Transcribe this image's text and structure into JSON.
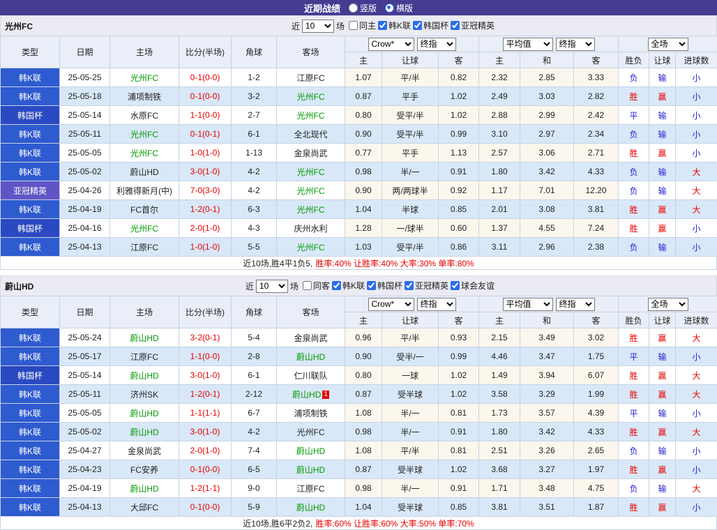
{
  "topbar": {
    "title": "近期战绩",
    "vertical_label": "竖版",
    "horizontal_label": "横版",
    "selected": "横版"
  },
  "league_colors": {
    "韩K联": "#2f5bd0",
    "韩国杯": "#2a49c2",
    "亚冠精英": "#6055c6"
  },
  "result_colors": {
    "win_red": "#e60000",
    "lose_blue": "#1f1fd0",
    "team_highlight_green": "#009900",
    "score_red": "#e60000"
  },
  "sections": [
    {
      "team": "光州FC",
      "filters": {
        "near_label": "近",
        "count": "10",
        "unit_label": "场",
        "checkboxes": [
          {
            "label": "同主",
            "checked": false
          },
          {
            "label": "韩K联",
            "checked": true
          },
          {
            "label": "韩国杯",
            "checked": true
          },
          {
            "label": "亚冠精英",
            "checked": true
          }
        ]
      },
      "selects": {
        "company": "Crow*",
        "company_stage": "终指",
        "average": "平均值",
        "average_stage": "终指",
        "scope": "全场"
      },
      "columns": {
        "type": "类型",
        "date": "日期",
        "home": "主场",
        "score": "比分(半场)",
        "corner": "角球",
        "away": "客场"
      },
      "sub_columns": [
        "主",
        "让球",
        "客",
        "主",
        "和",
        "客",
        "胜负",
        "让球",
        "进球数"
      ],
      "rows": [
        {
          "type": "韩K联",
          "date": "25-05-25",
          "home": "光州FC",
          "home_green": true,
          "score": "0-1(0-0)",
          "corner": "1-2",
          "away": "江原FC",
          "o1": "1.07",
          "hc": "平/半",
          "o2": "0.82",
          "a1": "2.32",
          "a2": "2.85",
          "a3": "3.33",
          "r1": "负",
          "r2": "输",
          "r3": "小"
        },
        {
          "type": "韩K联",
          "date": "25-05-18",
          "home": "浦项制铁",
          "score": "0-1(0-0)",
          "corner": "3-2",
          "away": "光州FC",
          "away_green": true,
          "o1": "0.87",
          "hc": "平手",
          "o2": "1.02",
          "a1": "2.49",
          "a2": "3.03",
          "a3": "2.82",
          "r1": "胜",
          "r2": "赢",
          "r3": "小"
        },
        {
          "type": "韩国杯",
          "date": "25-05-14",
          "home": "水原FC",
          "score": "1-1(0-0)",
          "corner": "2-7",
          "away": "光州FC",
          "away_green": true,
          "o1": "0.80",
          "hc": "受平/半",
          "o2": "1.02",
          "a1": "2.88",
          "a2": "2.99",
          "a3": "2.42",
          "r1": "平",
          "r2": "输",
          "r3": "小"
        },
        {
          "type": "韩K联",
          "date": "25-05-11",
          "home": "光州FC",
          "home_green": true,
          "score": "0-1(0-1)",
          "corner": "6-1",
          "away": "全北现代",
          "o1": "0.90",
          "hc": "受平/半",
          "o2": "0.99",
          "a1": "3.10",
          "a2": "2.97",
          "a3": "2.34",
          "r1": "负",
          "r2": "输",
          "r3": "小"
        },
        {
          "type": "韩K联",
          "date": "25-05-05",
          "home": "光州FC",
          "home_green": true,
          "score": "1-0(1-0)",
          "corner": "1-13",
          "away": "金泉尚武",
          "o1": "0.77",
          "hc": "平手",
          "o2": "1.13",
          "a1": "2.57",
          "a2": "3.06",
          "a3": "2.71",
          "r1": "胜",
          "r2": "赢",
          "r3": "小"
        },
        {
          "type": "韩K联",
          "date": "25-05-02",
          "home": "蔚山HD",
          "score": "3-0(1-0)",
          "corner": "4-2",
          "away": "光州FC",
          "away_green": true,
          "o1": "0.98",
          "hc": "半/一",
          "o2": "0.91",
          "a1": "1.80",
          "a2": "3.42",
          "a3": "4.33",
          "r1": "负",
          "r2": "输",
          "r3": "大"
        },
        {
          "type": "亚冠精英",
          "date": "25-04-26",
          "home": "利雅得新月(中)",
          "score": "7-0(3-0)",
          "corner": "4-2",
          "away": "光州FC",
          "away_green": true,
          "o1": "0.90",
          "hc": "两/两球半",
          "o2": "0.92",
          "a1": "1.17",
          "a2": "7.01",
          "a3": "12.20",
          "r1": "负",
          "r2": "输",
          "r3": "大"
        },
        {
          "type": "韩K联",
          "date": "25-04-19",
          "home": "FC首尔",
          "score": "1-2(0-1)",
          "corner": "6-3",
          "away": "光州FC",
          "away_green": true,
          "o1": "1.04",
          "hc": "半球",
          "o2": "0.85",
          "a1": "2.01",
          "a2": "3.08",
          "a3": "3.81",
          "r1": "胜",
          "r2": "赢",
          "r3": "大"
        },
        {
          "type": "韩国杯",
          "date": "25-04-16",
          "home": "光州FC",
          "home_green": true,
          "score": "2-0(1-0)",
          "corner": "4-3",
          "away": "庆州水利",
          "o1": "1.28",
          "hc": "一/球半",
          "o2": "0.60",
          "a1": "1.37",
          "a2": "4.55",
          "a3": "7.24",
          "r1": "胜",
          "r2": "赢",
          "r3": "小"
        },
        {
          "type": "韩K联",
          "date": "25-04-13",
          "home": "江原FC",
          "score": "1-0(1-0)",
          "corner": "5-5",
          "away": "光州FC",
          "away_green": true,
          "o1": "1.03",
          "hc": "受平/半",
          "o2": "0.86",
          "a1": "3.11",
          "a2": "2.96",
          "a3": "2.38",
          "r1": "负",
          "r2": "输",
          "r3": "小"
        }
      ],
      "summary": {
        "record": "近10场,胜4平1负5,",
        "stats": "胜率:40% 让胜率:40% 大率:30% 单率:80%"
      }
    },
    {
      "team": "蔚山HD",
      "filters": {
        "near_label": "近",
        "count": "10",
        "unit_label": "场",
        "checkboxes": [
          {
            "label": "同客",
            "checked": false
          },
          {
            "label": "韩K联",
            "checked": true
          },
          {
            "label": "韩国杯",
            "checked": true
          },
          {
            "label": "亚冠精英",
            "checked": true
          },
          {
            "label": "球会友谊",
            "checked": true
          }
        ]
      },
      "selects": {
        "company": "Crow*",
        "company_stage": "终指",
        "average": "平均值",
        "average_stage": "终指",
        "scope": "全场"
      },
      "columns": {
        "type": "类型",
        "date": "日期",
        "home": "主场",
        "score": "比分(半场)",
        "corner": "角球",
        "away": "客场"
      },
      "sub_columns": [
        "主",
        "让球",
        "客",
        "主",
        "和",
        "客",
        "胜负",
        "让球",
        "进球数"
      ],
      "rows": [
        {
          "type": "韩K联",
          "date": "25-05-24",
          "home": "蔚山HD",
          "home_green": true,
          "score": "3-2(0-1)",
          "corner": "5-4",
          "away": "金泉尚武",
          "o1": "0.96",
          "hc": "平/半",
          "o2": "0.93",
          "a1": "2.15",
          "a2": "3.49",
          "a3": "3.02",
          "r1": "胜",
          "r2": "赢",
          "r3": "大"
        },
        {
          "type": "韩K联",
          "date": "25-05-17",
          "home": "江原FC",
          "score": "1-1(0-0)",
          "corner": "2-8",
          "away": "蔚山HD",
          "away_green": true,
          "o1": "0.90",
          "hc": "受半/一",
          "o2": "0.99",
          "a1": "4.46",
          "a2": "3.47",
          "a3": "1.75",
          "r1": "平",
          "r2": "输",
          "r3": "小"
        },
        {
          "type": "韩国杯",
          "date": "25-05-14",
          "home": "蔚山HD",
          "home_green": true,
          "score": "3-0(1-0)",
          "corner": "6-1",
          "away": "仁川联队",
          "o1": "0.80",
          "hc": "一球",
          "o2": "1.02",
          "a1": "1.49",
          "a2": "3.94",
          "a3": "6.07",
          "r1": "胜",
          "r2": "赢",
          "r3": "大"
        },
        {
          "type": "韩K联",
          "date": "25-05-11",
          "home": "济州SK",
          "score": "1-2(0-1)",
          "corner": "2-12",
          "away": "蔚山HD",
          "away_green": true,
          "away_badge": "1",
          "o1": "0.87",
          "hc": "受半球",
          "o2": "1.02",
          "a1": "3.58",
          "a2": "3.29",
          "a3": "1.99",
          "r1": "胜",
          "r2": "赢",
          "r3": "大"
        },
        {
          "type": "韩K联",
          "date": "25-05-05",
          "home": "蔚山HD",
          "home_green": true,
          "score": "1-1(1-1)",
          "corner": "6-7",
          "away": "浦项制铁",
          "o1": "1.08",
          "hc": "半/一",
          "o2": "0.81",
          "a1": "1.73",
          "a2": "3.57",
          "a3": "4.39",
          "r1": "平",
          "r2": "输",
          "r3": "小"
        },
        {
          "type": "韩K联",
          "date": "25-05-02",
          "home": "蔚山HD",
          "home_green": true,
          "score": "3-0(1-0)",
          "corner": "4-2",
          "away": "光州FC",
          "o1": "0.98",
          "hc": "半/一",
          "o2": "0.91",
          "a1": "1.80",
          "a2": "3.42",
          "a3": "4.33",
          "r1": "胜",
          "r2": "赢",
          "r3": "大"
        },
        {
          "type": "韩K联",
          "date": "25-04-27",
          "home": "金泉尚武",
          "score": "2-0(1-0)",
          "corner": "7-4",
          "away": "蔚山HD",
          "away_green": true,
          "o1": "1.08",
          "hc": "平/半",
          "o2": "0.81",
          "a1": "2.51",
          "a2": "3.26",
          "a3": "2.65",
          "r1": "负",
          "r2": "输",
          "r3": "小"
        },
        {
          "type": "韩K联",
          "date": "25-04-23",
          "home": "FC安养",
          "score": "0-1(0-0)",
          "corner": "6-5",
          "away": "蔚山HD",
          "away_green": true,
          "o1": "0.87",
          "hc": "受半球",
          "o2": "1.02",
          "a1": "3.68",
          "a2": "3.27",
          "a3": "1.97",
          "r1": "胜",
          "r2": "赢",
          "r3": "小"
        },
        {
          "type": "韩K联",
          "date": "25-04-19",
          "home": "蔚山HD",
          "home_green": true,
          "score": "1-2(1-1)",
          "corner": "9-0",
          "away": "江原FC",
          "o1": "0.98",
          "hc": "半/一",
          "o2": "0.91",
          "a1": "1.71",
          "a2": "3.48",
          "a3": "4.75",
          "r1": "负",
          "r2": "输",
          "r3": "大"
        },
        {
          "type": "韩K联",
          "date": "25-04-13",
          "home": "大邱FC",
          "score": "0-1(0-0)",
          "corner": "5-9",
          "away": "蔚山HD",
          "away_green": true,
          "o1": "1.04",
          "hc": "受半球",
          "o2": "0.85",
          "a1": "3.81",
          "a2": "3.51",
          "a3": "1.87",
          "r1": "胜",
          "r2": "赢",
          "r3": "小"
        }
      ],
      "summary": {
        "record": "近10场,胜6平2负2,",
        "stats": "胜率:60% 让胜率:60% 大率:50% 单率:70%"
      }
    }
  ]
}
